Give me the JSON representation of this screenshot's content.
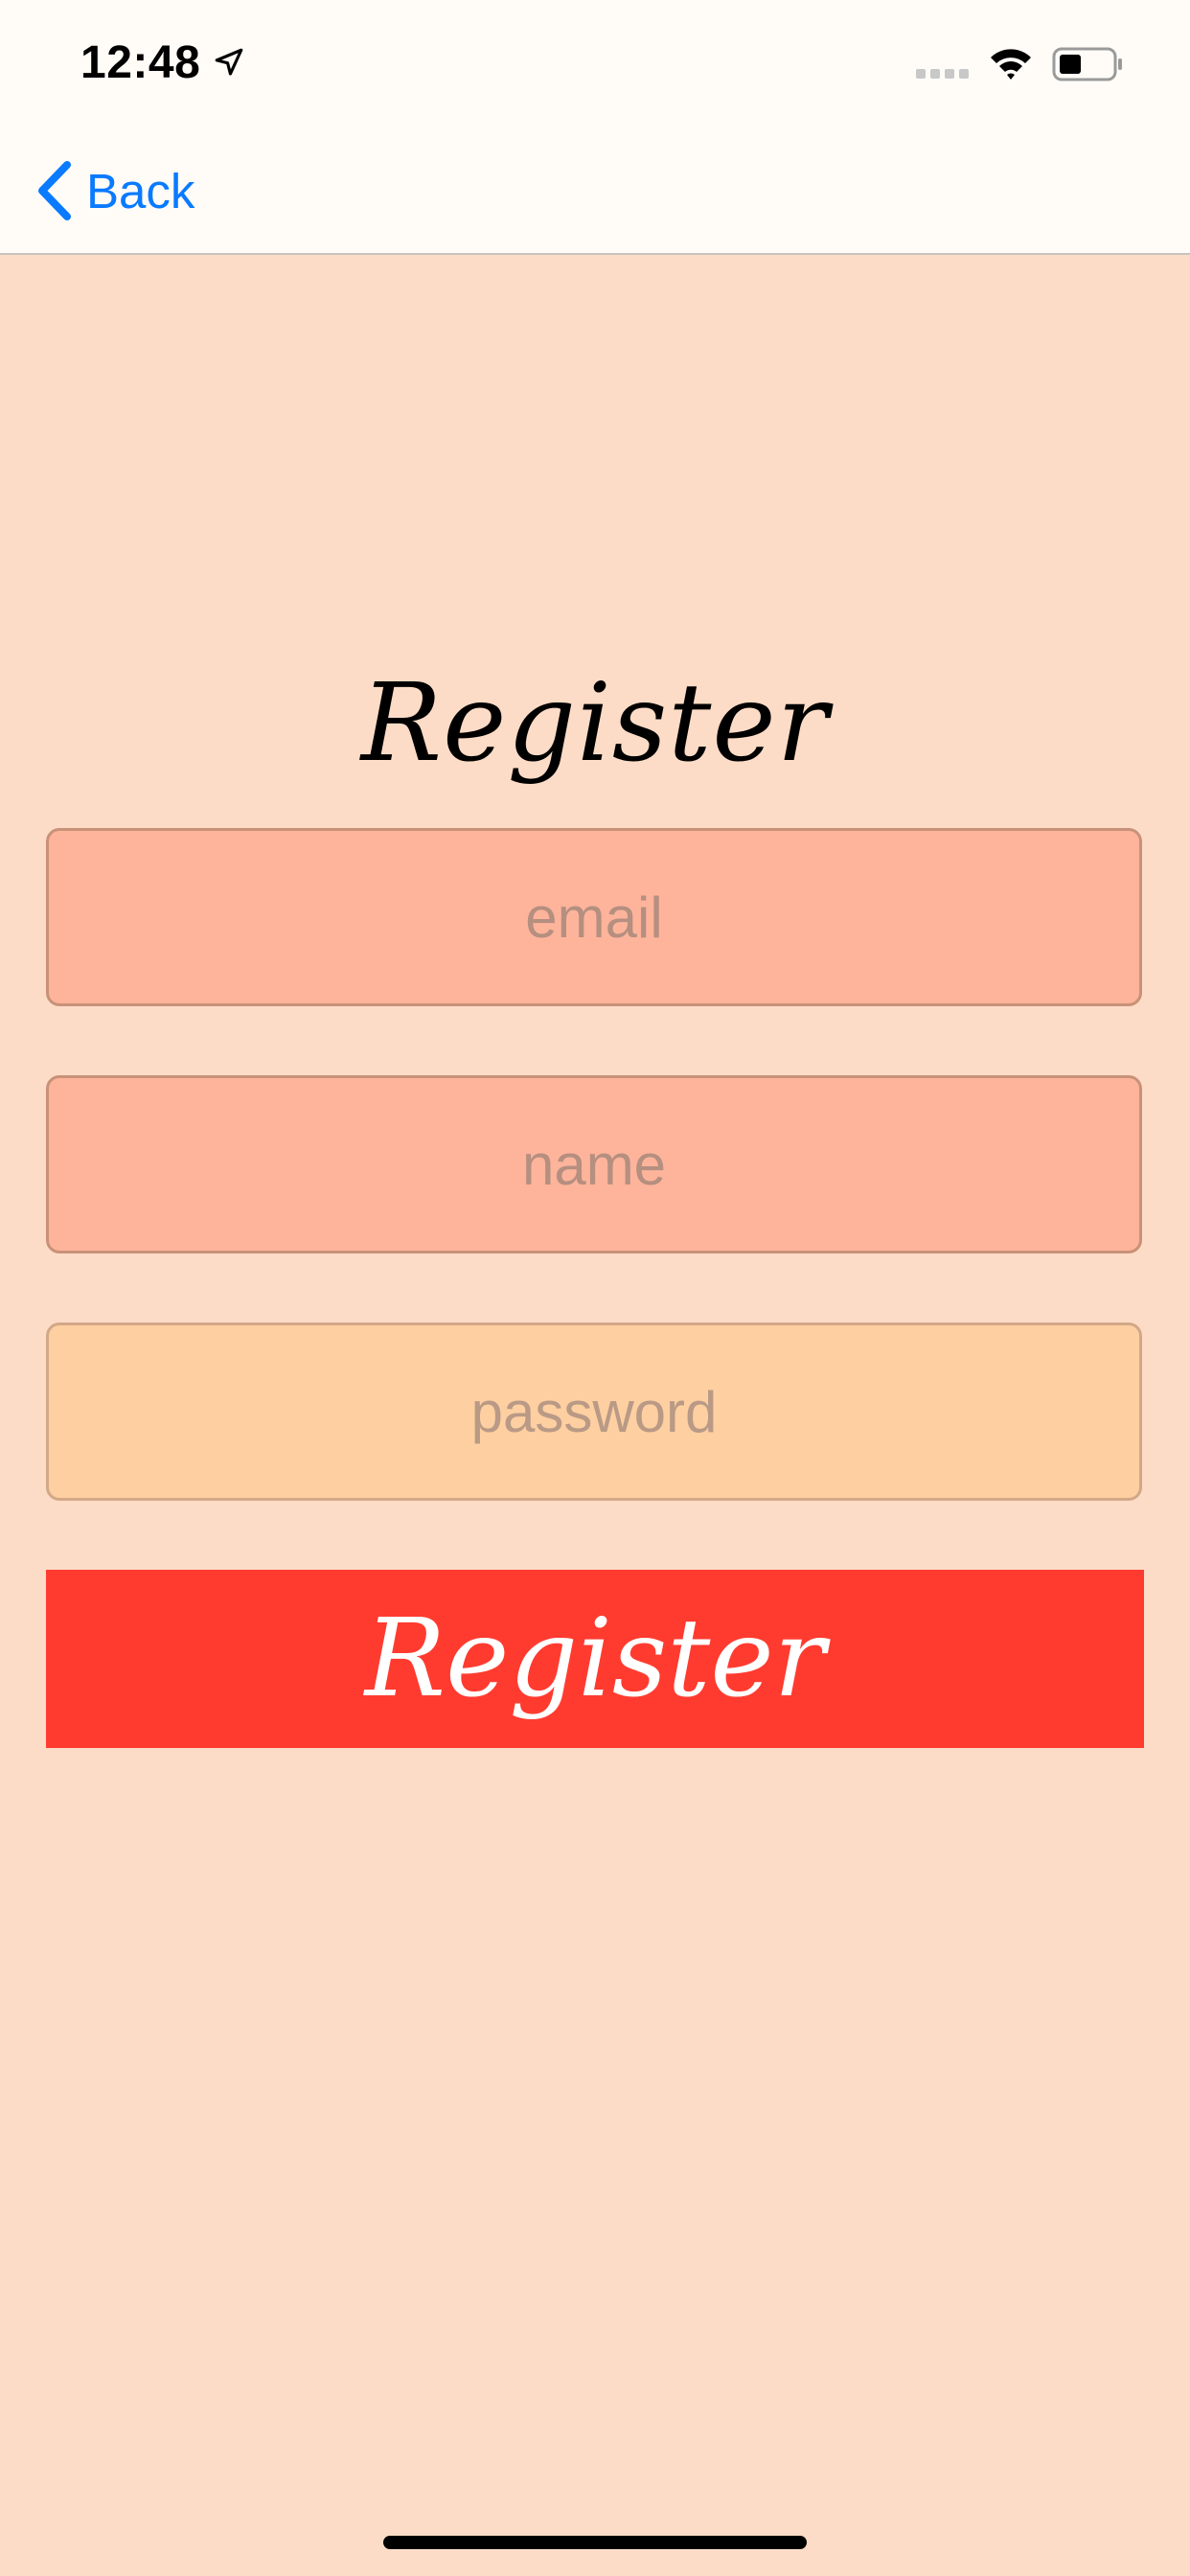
{
  "status_bar": {
    "time": "12:48",
    "icons": [
      "location-arrow-icon",
      "cellular-signal-icon",
      "wifi-icon",
      "battery-icon"
    ]
  },
  "nav": {
    "back_label": "Back",
    "back_icon": "chevron-left-icon"
  },
  "form": {
    "title": "Register",
    "email_placeholder": "email",
    "email_value": "",
    "name_placeholder": "name",
    "name_value": "",
    "password_placeholder": "password",
    "password_value": "",
    "submit_label": "Register"
  },
  "colors": {
    "background": "#fddcc7",
    "bar_background": "#fffcf8",
    "accent_blue": "#0a7aff",
    "email_field": "#feb49b",
    "name_field": "#feb49b",
    "password_field": "#fecfa0",
    "register_button": "#ff3b30"
  }
}
